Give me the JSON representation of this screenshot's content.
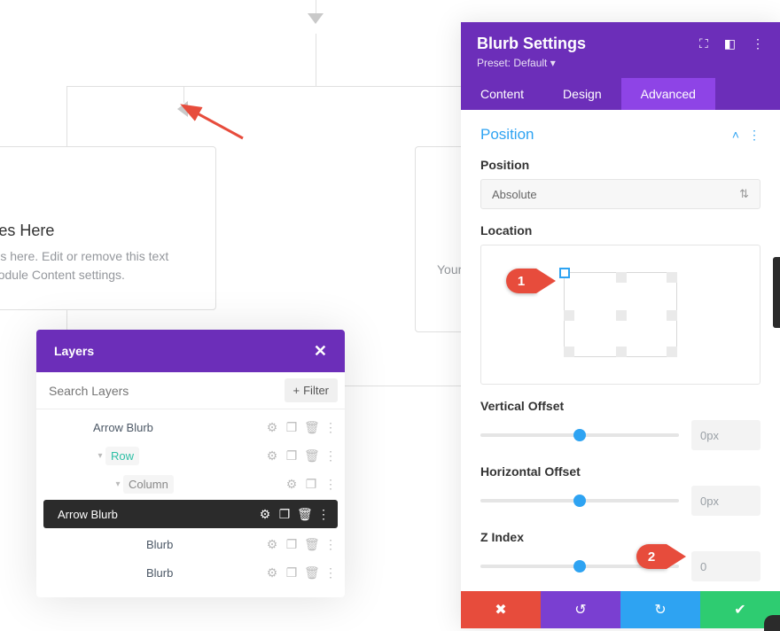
{
  "canvas": {
    "blurb": {
      "title": "Your Title Goes Here",
      "body": "Your content goes here. Edit or remove this text inline or in the module Content settings.",
      "preview_word": "Your"
    }
  },
  "layers": {
    "title": "Layers",
    "search_placeholder": "Search Layers",
    "filter_label": "Filter",
    "items": [
      {
        "name": "Arrow Blurb",
        "depth": 0,
        "selected": false
      },
      {
        "name": "Row",
        "depth": 1,
        "selected": false,
        "teal": true
      },
      {
        "name": "Column",
        "depth": 2,
        "selected": false
      },
      {
        "name": "Arrow Blurb",
        "depth": 3,
        "selected": true
      },
      {
        "name": "Blurb",
        "depth": 3,
        "selected": false
      },
      {
        "name": "Blurb",
        "depth": 3,
        "selected": false
      }
    ]
  },
  "settings": {
    "title": "Blurb Settings",
    "preset": "Preset: Default",
    "tabs": {
      "content": "Content",
      "design": "Design",
      "advanced": "Advanced"
    },
    "section": "Position",
    "position_label": "Position",
    "position_value": "Absolute",
    "location_label": "Location",
    "vertical_label": "Vertical Offset",
    "vertical_value": "0px",
    "horizontal_label": "Horizontal Offset",
    "horizontal_value": "0px",
    "zindex_label": "Z Index",
    "zindex_value": "0",
    "callouts": {
      "one": "1",
      "two": "2"
    }
  }
}
